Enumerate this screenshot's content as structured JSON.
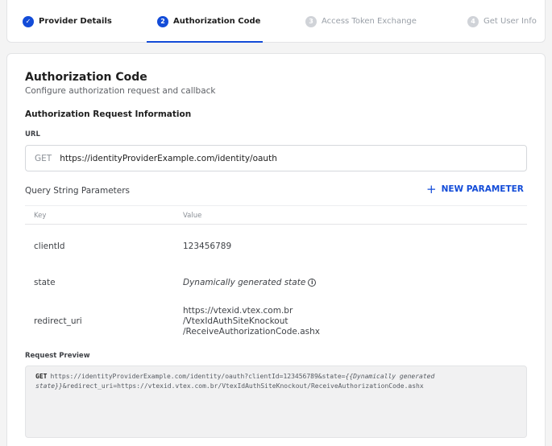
{
  "stepper": {
    "steps": [
      {
        "number": "✓",
        "label": "Provider Details",
        "state": "done"
      },
      {
        "number": "2",
        "label": "Authorization Code",
        "state": "active"
      },
      {
        "number": "3",
        "label": "Access Token Exchange",
        "state": "pending"
      },
      {
        "number": "4",
        "label": "Get User Info",
        "state": "pending"
      }
    ]
  },
  "card": {
    "title": "Authorization Code",
    "subtitle": "Configure authorization request and callback",
    "section_heading": "Authorization Request Information",
    "url_label": "URL",
    "method": "GET",
    "url": "https://identityProviderExample.com/identity/oauth",
    "query_params_label": "Query String Parameters",
    "new_parameter_label": "NEW PARAMETER",
    "table": {
      "headers": {
        "key": "Key",
        "value": "Value"
      },
      "rows": [
        {
          "key": "clientId",
          "value": "123456789"
        },
        {
          "key": "state",
          "value": "Dynamically generated state"
        },
        {
          "key": "redirect_uri",
          "value_lines": [
            "https://vtexid.vtex.com.br",
            "/VtexIdAuthSiteKnockout",
            "/ReceiveAuthorizationCode.ashx"
          ]
        }
      ]
    },
    "preview_label": "Request Preview",
    "preview": {
      "verb": "GET",
      "part1": "https://identityProviderExample.com/identity/oauth?clientId=123456789&state=",
      "dynamic": "{{Dynamically generated state}}",
      "part2": "&redirect_uri=https://vtexid.vtex.com.br/VtexIdAuthSiteKnockout/ReceiveAuthorizationCode.ashx"
    }
  },
  "colors": {
    "accent": "#134cd8",
    "pending": "#d0d3d8"
  },
  "icons": {
    "done": "check-icon",
    "info": "info-icon",
    "add": "plus-icon"
  }
}
